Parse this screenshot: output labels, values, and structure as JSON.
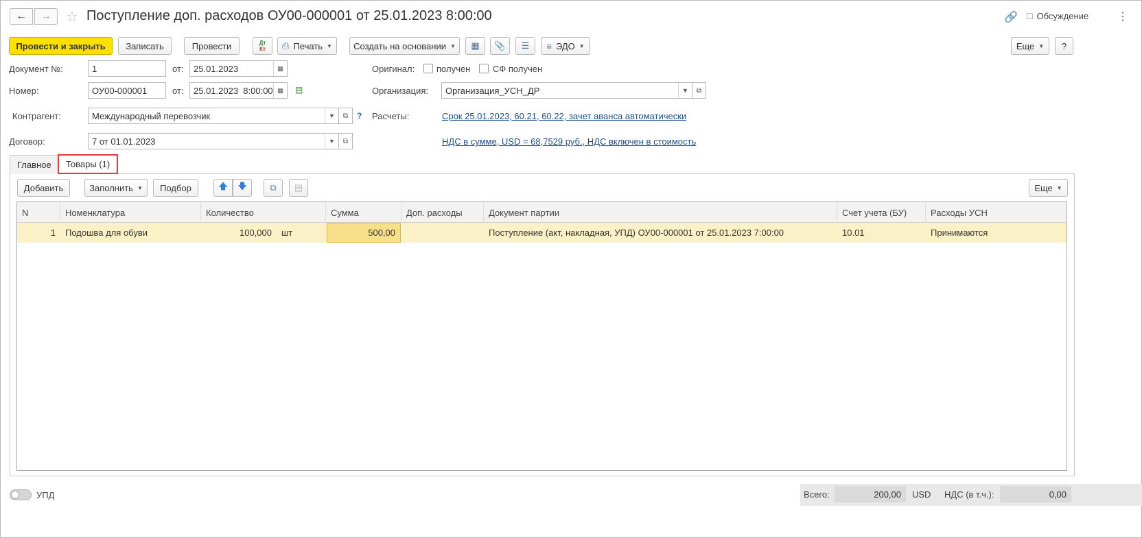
{
  "window": {
    "title": "Поступление доп. расходов ОУ00-000001 от 25.01.2023 8:00:00",
    "discussion_label": "Обсуждение"
  },
  "toolbar": {
    "post_and_close": "Провести и закрыть",
    "save": "Записать",
    "post": "Провести",
    "dtkt_top": "Дт",
    "dtkt_bottom": "Кт",
    "print": "Печать",
    "create_based_on": "Создать на основании",
    "edo": "ЭДО",
    "more": "Еще",
    "help": "?"
  },
  "form": {
    "doc_number_label": "Документ №:",
    "doc_number_value": "1",
    "from_label": "от:",
    "doc_date_value": "25.01.2023",
    "number_label": "Номер:",
    "number_value": "ОУ00-000001",
    "number_datetime_value": "25.01.2023  8:00:00",
    "original_label": "Оригинал:",
    "received_label": "получен",
    "sf_received_label": "СФ получен",
    "organization_label": "Организация:",
    "organization_value": "Организация_УСН_ДР",
    "counterparty_label": "Контрагент:",
    "counterparty_value": "Международный перевозчик",
    "help_mark": "?",
    "settlements_label": "Расчеты:",
    "settlements_link": "Срок 25.01.2023, 60.21, 60.22, зачет аванса автоматически",
    "contract_label": "Договор:",
    "contract_value": "7 от 01.01.2023",
    "vat_link": "НДС в сумме, USD = 68,7529 руб., НДС включен в стоимость"
  },
  "tabs": {
    "main": "Главное",
    "goods": "Товары (1)"
  },
  "table_toolbar": {
    "add": "Добавить",
    "fill": "Заполнить",
    "pick": "Подбор",
    "more": "Еще"
  },
  "table": {
    "headers": {
      "n": "N",
      "nomenclature": "Номенклатура",
      "quantity": "Количество",
      "sum": "Сумма",
      "extra_costs": "Доп. расходы",
      "batch_doc": "Документ партии",
      "account": "Счет учета (БУ)",
      "usn_expenses": "Расходы УСН"
    },
    "rows": [
      {
        "n": "1",
        "nomenclature": "Подошва для обуви",
        "quantity": "100,000",
        "unit": "шт",
        "sum": "500,00",
        "extra_costs": "",
        "batch_doc": "Поступление (акт, накладная, УПД) ОУ00-000001 от 25.01.2023 7:00:00",
        "account": "10.01",
        "usn_expenses": "Принимаются"
      }
    ]
  },
  "footer": {
    "upd_label": "УПД",
    "total_label": "Всего:",
    "total_value": "200,00",
    "currency": "USD",
    "vat_label": "НДС (в т.ч.):",
    "vat_value": "0,00"
  },
  "colors": {
    "primary_button": "#fbe000",
    "selected_row": "#fbf1c6",
    "link": "#1f4d8c",
    "tab_highlight": "#e23b3b"
  }
}
